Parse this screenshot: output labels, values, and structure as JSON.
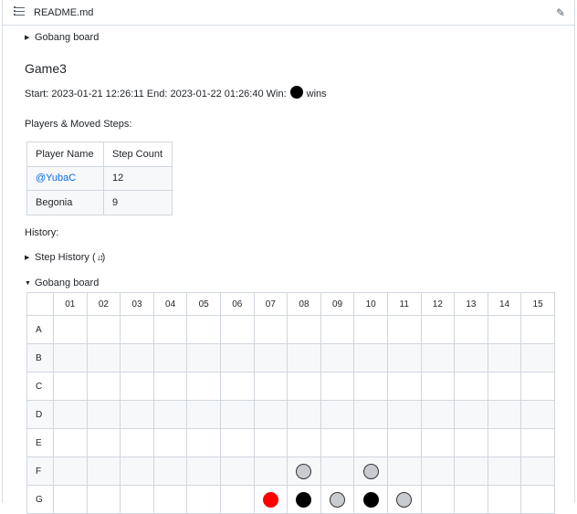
{
  "header": {
    "title": "README.md",
    "list_icon": "list-icon",
    "edit_icon": "pencil-icon"
  },
  "collapsed_board_summary": "Gobang board",
  "game_title": "Game3",
  "meta": {
    "start_label": "Start:",
    "start": "2023-01-21 12:26:11",
    "end_label": "End:",
    "end": "2023-01-22 01:26:40",
    "win_label": "Win:",
    "winner_stone": "black",
    "wins_text": "wins"
  },
  "players_label": "Players & Moved Steps:",
  "players_table": {
    "headers": [
      "Player Name",
      "Step Count"
    ],
    "rows": [
      {
        "name": "@YubaC",
        "steps": "12"
      },
      {
        "name": "Begonia",
        "steps": "9"
      }
    ]
  },
  "history_label": "History:",
  "step_history_summary": "Step History (",
  "step_history_close": ")",
  "step_history_icon": "sort-arrows-icon",
  "board_summary": "Gobang board",
  "board": {
    "columns": [
      "01",
      "02",
      "03",
      "04",
      "05",
      "06",
      "07",
      "08",
      "09",
      "10",
      "11",
      "12",
      "13",
      "14",
      "15"
    ],
    "rows": [
      "A",
      "B",
      "C",
      "D",
      "E",
      "F",
      "G"
    ],
    "stones": [
      {
        "row": "F",
        "col": "08",
        "type": "grey"
      },
      {
        "row": "F",
        "col": "10",
        "type": "grey"
      },
      {
        "row": "G",
        "col": "07",
        "type": "red"
      },
      {
        "row": "G",
        "col": "08",
        "type": "black"
      },
      {
        "row": "G",
        "col": "09",
        "type": "grey"
      },
      {
        "row": "G",
        "col": "10",
        "type": "black"
      },
      {
        "row": "G",
        "col": "11",
        "type": "grey"
      }
    ]
  }
}
